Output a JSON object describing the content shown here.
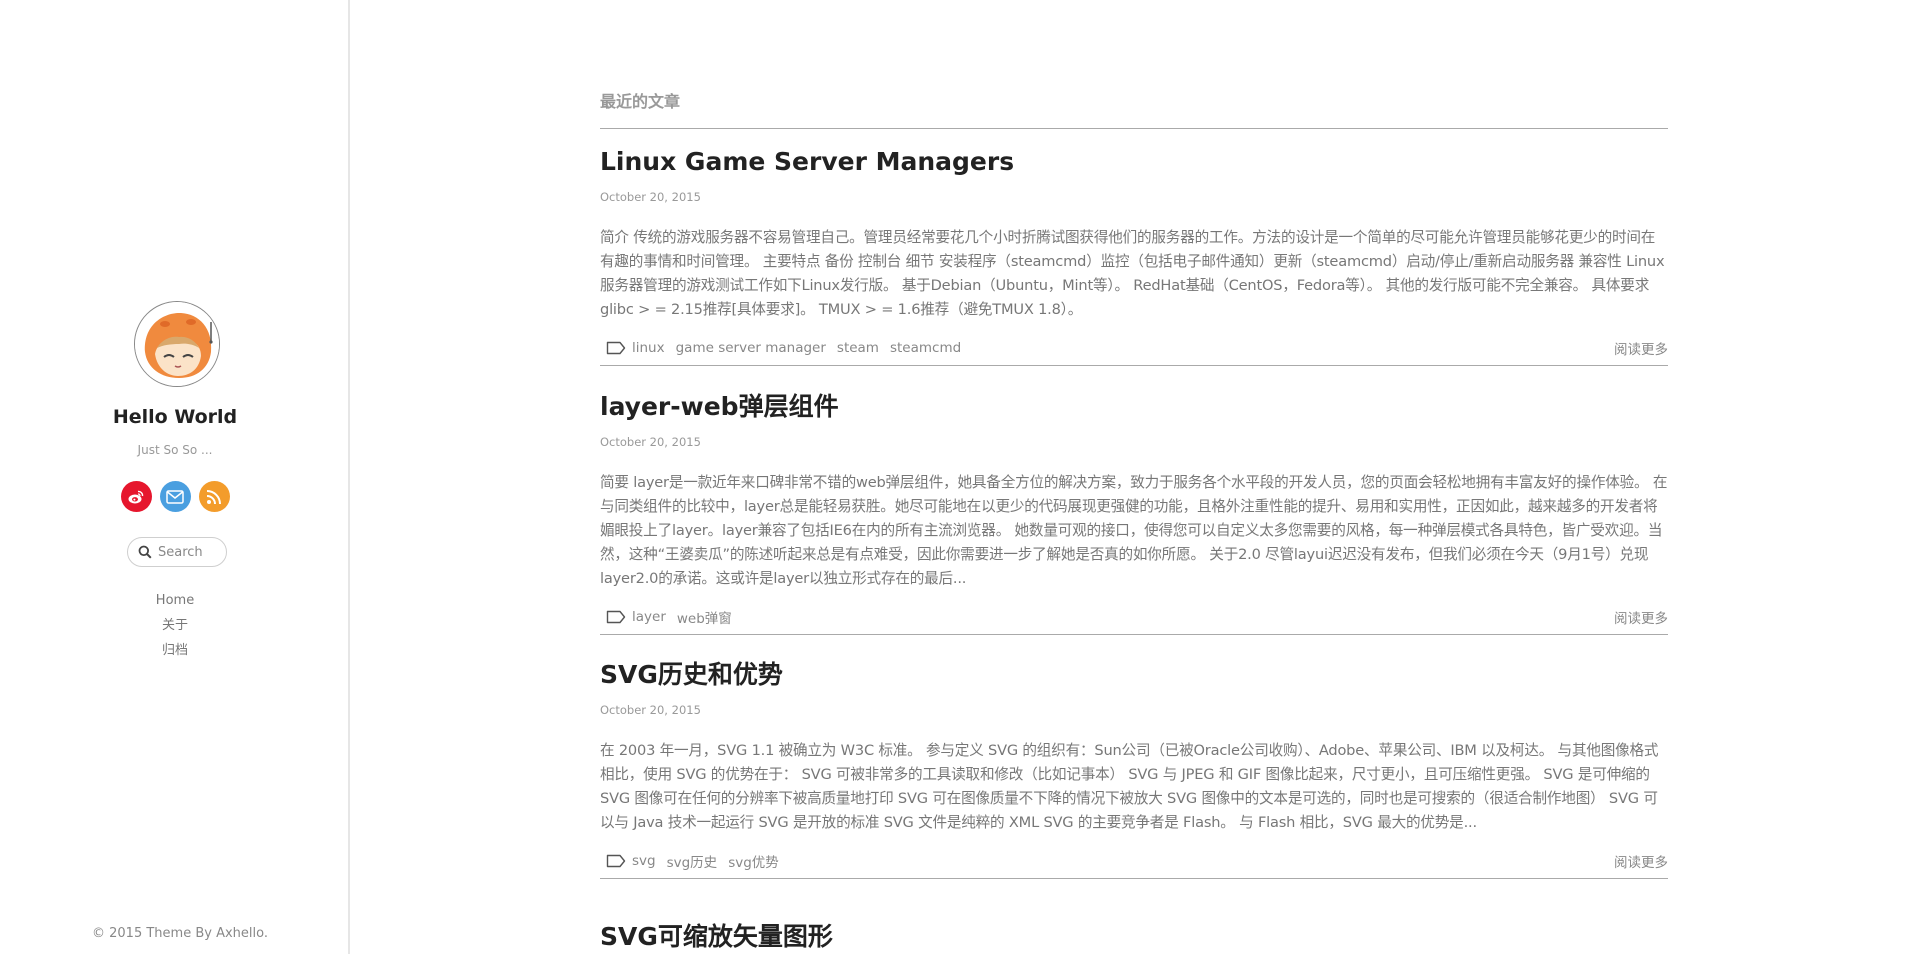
{
  "sidebar": {
    "title": "Hello World",
    "subtitle": "Just So So ...",
    "social": [
      {
        "name": "weibo-icon",
        "color": "#e6162d"
      },
      {
        "name": "mail-icon",
        "color": "#4a9fe0"
      },
      {
        "name": "rss-icon",
        "color": "#f39c2b"
      }
    ],
    "search": {
      "placeholder": "Search"
    },
    "nav": [
      "Home",
      "关于",
      "归档"
    ],
    "footer": "© 2015 Theme By Axhello."
  },
  "main": {
    "section_title": "最近的文章",
    "read_more": "阅读更多",
    "posts": [
      {
        "title": "Linux Game Server Managers",
        "date": "October 20, 2015",
        "excerpt": "简介 传统的游戏服务器不容易管理自己。管理员经常要花几个小时折腾试图获得他们的服务器的工作。方法的设计是一个简单的尽可能允许管理员能够花更少的时间在有趣的事情和时间管理。 主要特点 备份 控制台 细节 安装程序（steamcmd）监控（包括电子邮件通知）更新（steamcmd）启动/停止/重新启动服务器 兼容性 Linux服务器管理的游戏测试工作如下Linux发行版。 基于Debian（Ubuntu，Mint等）。 RedHat基础（CentOS，Fedora等）。 其他的发行版可能不完全兼容。 具体要求 glibc > = 2.15推荐[具体要求]。 TMUX > = 1.6推荐（避免TMUX 1.8）。",
        "tags": [
          "linux",
          "game server manager",
          "steam",
          "steamcmd"
        ]
      },
      {
        "title": "layer-web弹层组件",
        "date": "October 20, 2015",
        "excerpt": "简要 layer是一款近年来口碑非常不错的web弹层组件，她具备全方位的解决方案，致力于服务各个水平段的开发人员，您的页面会轻松地拥有丰富友好的操作体验。 在与同类组件的比较中，layer总是能轻易获胜。她尽可能地在以更少的代码展现更强健的功能，且格外注重性能的提升、易用和实用性，正因如此，越来越多的开发者将媚眼投上了layer。layer兼容了包括IE6在内的所有主流浏览器。 她数量可观的接口，使得您可以自定义太多您需要的风格，每一种弹层模式各具特色，皆广受欢迎。当然，这种“王婆卖瓜”的陈述听起来总是有点难受，因此你需要进一步了解她是否真的如你所愿。 关于2.0 尽管layui迟迟没有发布，但我们必须在今天（9月1号）兑现layer2.0的承诺。这或许是layer以独立形式存在的最后...",
        "tags": [
          "layer",
          "web弹窗"
        ]
      },
      {
        "title": "SVG历史和优势",
        "date": "October 20, 2015",
        "excerpt": "在 2003 年一月，SVG 1.1 被确立为 W3C 标准。 参与定义 SVG 的组织有：Sun公司（已被Oracle公司收购）、Adobe、苹果公司、IBM 以及柯达。 与其他图像格式相比，使用 SVG 的优势在于： SVG 可被非常多的工具读取和修改（比如记事本） SVG 与 JPEG 和 GIF 图像比起来，尺寸更小，且可压缩性更强。 SVG 是可伸缩的 SVG 图像可在任何的分辨率下被高质量地打印 SVG 可在图像质量不下降的情况下被放大 SVG 图像中的文本是可选的，同时也是可搜索的（很适合制作地图） SVG 可以与 Java 技术一起运行 SVG 是开放的标准 SVG 文件是纯粹的 XML SVG 的主要竞争者是 Flash。 与 Flash 相比，SVG 最大的优势是...",
        "tags": [
          "svg",
          "svg历史",
          "svg优势"
        ]
      }
    ],
    "last_post_title": "SVG可缩放矢量图形"
  }
}
